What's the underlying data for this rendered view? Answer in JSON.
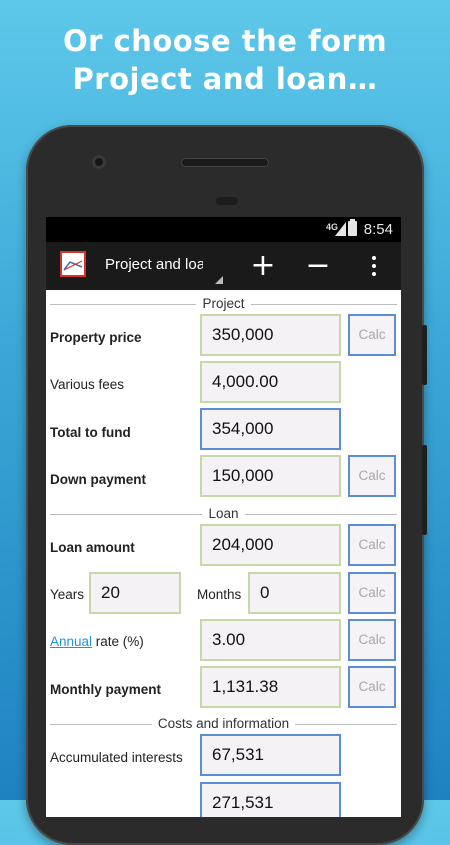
{
  "promo": {
    "line1": "Or choose the form",
    "line2": "Project and loan…"
  },
  "status_bar": {
    "network": "4G",
    "time": "8:54"
  },
  "app_bar": {
    "title": "Project and loan",
    "plus_label": "+",
    "minus_label": "−"
  },
  "sections": {
    "project": "Project",
    "loan": "Loan",
    "costs": "Costs and information"
  },
  "form": {
    "property_price": {
      "label": "Property price",
      "value": "350,000",
      "calc": "Calc"
    },
    "various_fees": {
      "label": "Various fees",
      "value": "4,000.00"
    },
    "total_to_fund": {
      "label": "Total to fund",
      "value": "354,000"
    },
    "down_payment": {
      "label": "Down payment",
      "value": "150,000",
      "calc": "Calc"
    },
    "loan_amount": {
      "label": "Loan amount",
      "value": "204,000",
      "calc": "Calc"
    },
    "years": {
      "label": "Years",
      "value": "20"
    },
    "months": {
      "label": "Months",
      "value": "0",
      "calc": "Calc"
    },
    "annual_rate": {
      "link": "Annual",
      "label_rest": " rate (%)",
      "value": "3.00",
      "calc": "Calc"
    },
    "monthly_payment": {
      "label": "Monthly payment",
      "value": "1,131.38",
      "calc": "Calc"
    },
    "accumulated_interests": {
      "label": "Accumulated interests",
      "value": "67,531"
    },
    "next_value": {
      "value": "271,531"
    }
  },
  "colors": {
    "accent_blue": "#5a8fd6",
    "field_green": "#c6d8a8",
    "link": "#1e95d8",
    "logo_red": "#d9302a"
  }
}
